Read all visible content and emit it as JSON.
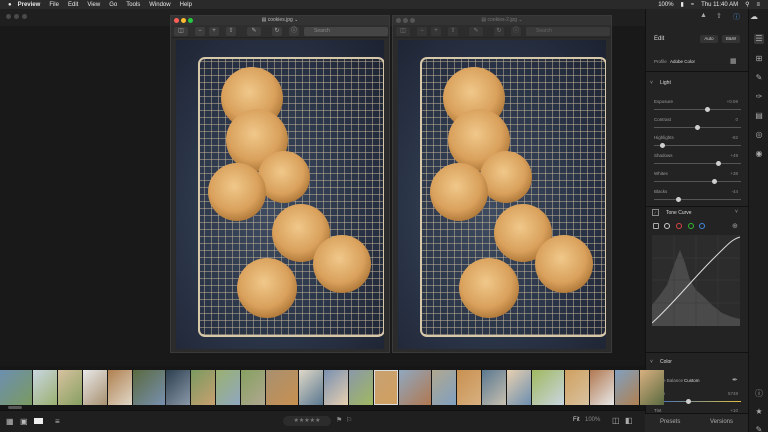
{
  "menubar": {
    "apple": "",
    "app_name": "Preview",
    "items": [
      "File",
      "Edit",
      "View",
      "Go",
      "Tools",
      "Window",
      "Help"
    ],
    "battery": "100%",
    "clock": "Thu 11:40 AM"
  },
  "windows": [
    {
      "title": "cookies.jpg"
    },
    {
      "title": "cookies-2.jpg"
    }
  ],
  "preview_toolbar": {
    "search_placeholder": "Search"
  },
  "panel": {
    "title": "Edit",
    "auto_button": "Auto",
    "bw_button": "B&W",
    "profile_label": "Profile",
    "profile_value": "Adobe Color",
    "light_section": "Light",
    "sliders": [
      {
        "label": "Exposure",
        "value": "+0.59",
        "pos": 0.62
      },
      {
        "label": "Contrast",
        "value": "0",
        "pos": 0.5
      },
      {
        "label": "Highlights",
        "value": "-82",
        "pos": 0.1
      },
      {
        "label": "Shadows",
        "value": "+49",
        "pos": 0.74
      },
      {
        "label": "Whites",
        "value": "+38",
        "pos": 0.69
      },
      {
        "label": "Blacks",
        "value": "-44",
        "pos": 0.28
      }
    ],
    "tone_curve": "Tone Curve",
    "color_section": "Color",
    "white_balance_label": "White Balance",
    "white_balance_value": "Custom",
    "color_sliders": [
      {
        "label": "Temp",
        "value": "5748",
        "pos": 0.4
      },
      {
        "label": "Tint",
        "value": "+10",
        "pos": 0.55
      }
    ],
    "presets_tab": "Presets",
    "versions_tab": "Versions"
  },
  "bottombar": {
    "fit_label": "Fit",
    "zoom_value": "100%"
  },
  "colors": {
    "panel_bg": "#232323",
    "accent": "#4a90d9",
    "cookie": "#d9a15c"
  }
}
